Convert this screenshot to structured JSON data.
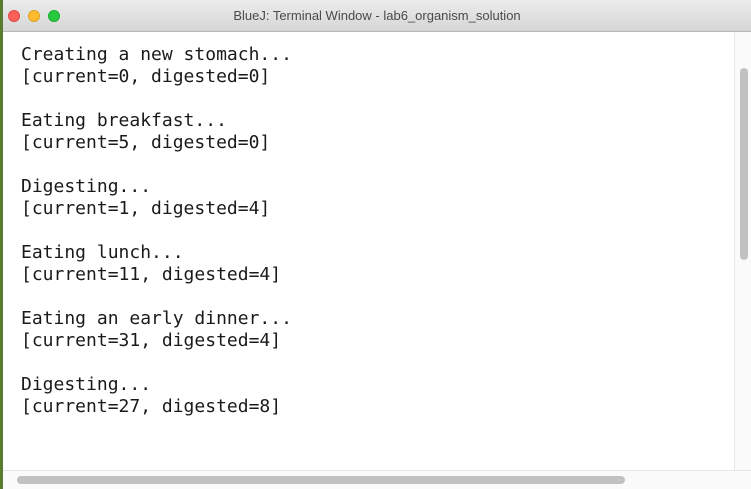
{
  "window": {
    "title": "BlueJ: Terminal Window - lab6_organism_solution"
  },
  "terminal": {
    "lines": [
      "Creating a new stomach...",
      "[current=0, digested=0]",
      "",
      "Eating breakfast...",
      "[current=5, digested=0]",
      "",
      "Digesting...",
      "[current=1, digested=4]",
      "",
      "Eating lunch...",
      "[current=11, digested=4]",
      "",
      "Eating an early dinner...",
      "[current=31, digested=4]",
      "",
      "Digesting...",
      "[current=27, digested=8]"
    ]
  },
  "colors": {
    "close": "#fc5f57",
    "minimize": "#fdbc2e",
    "maximize": "#28c840"
  }
}
